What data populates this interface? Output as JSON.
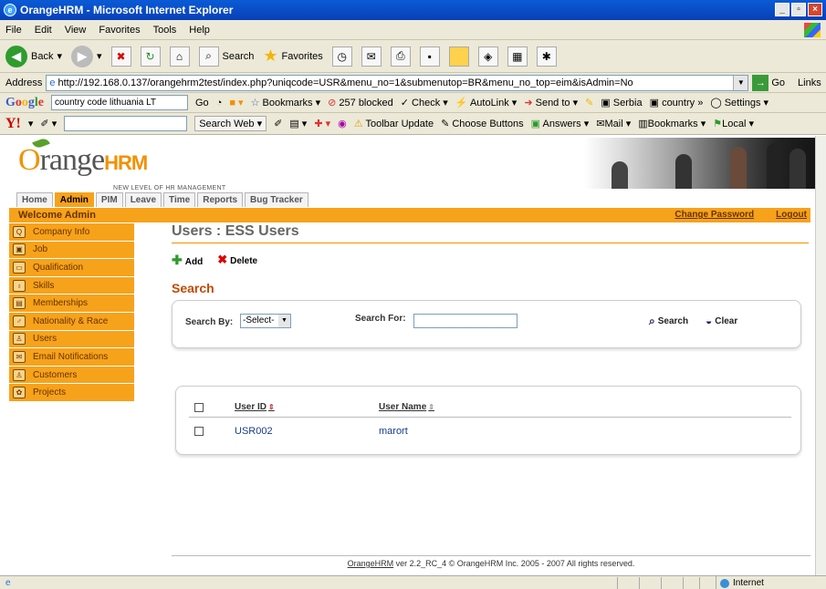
{
  "window": {
    "title": "OrangeHRM - Microsoft Internet Explorer"
  },
  "menu": {
    "items": [
      "File",
      "Edit",
      "View",
      "Favorites",
      "Tools",
      "Help"
    ]
  },
  "toolbar": {
    "back_label": "Back",
    "search_label": "Search",
    "favorites_label": "Favorites"
  },
  "address": {
    "label": "Address",
    "url": "http://192.168.0.137/orangehrm2test/index.php?uniqcode=USR&menu_no=1&submenutop=BR&menu_no_top=eim&isAdmin=No",
    "go_label": "Go",
    "links_label": "Links"
  },
  "google_toolbar": {
    "logo": "Google",
    "search_value": "country code lithuania LT",
    "go_label": "Go",
    "bookmarks_label": "Bookmarks",
    "blocked_label": "257 blocked",
    "check_label": "Check",
    "autolink_label": "AutoLink",
    "sendto_label": "Send to",
    "serbia_label": "Serbia",
    "country_label": "country",
    "settings_label": "Settings"
  },
  "yahoo_toolbar": {
    "logo": "Y!",
    "search_web_label": "Search Web",
    "toolbar_update_label": "Toolbar Update",
    "choose_buttons_label": "Choose Buttons",
    "answers_label": "Answers",
    "mail_label": "Mail",
    "bookmarks_label": "Bookmarks",
    "local_label": "Local"
  },
  "app": {
    "logo_text": "range",
    "logo_suffix": "HRM",
    "tagline": "NEW LEVEL OF HR MANAGEMENT",
    "tabs": [
      {
        "label": "Home",
        "active": false
      },
      {
        "label": "Admin",
        "active": true
      },
      {
        "label": "PIM",
        "active": false
      },
      {
        "label": "Leave",
        "active": false
      },
      {
        "label": "Time",
        "active": false
      },
      {
        "label": "Reports",
        "active": false
      },
      {
        "label": "Bug Tracker",
        "active": false
      }
    ],
    "welcome": "Welcome Admin",
    "change_password": "Change Password",
    "logout": "Logout",
    "sidebar": [
      "Company Info",
      "Job",
      "Qualification",
      "Skills",
      "Memberships",
      "Nationality & Race",
      "Users",
      "Email Notifications",
      "Customers",
      "Projects"
    ],
    "page_title": "Users : ESS Users",
    "add_label": "Add",
    "delete_label": "Delete",
    "search_title": "Search",
    "search_by_label": "Search By:",
    "search_by_value": "-Select-",
    "search_for_label": "Search For:",
    "search_for_value": "",
    "search_button": "Search",
    "clear_button": "Clear",
    "table": {
      "columns": [
        "User ID",
        "User Name"
      ],
      "rows": [
        {
          "user_id": "USR002",
          "user_name": "marort"
        }
      ]
    },
    "footer_link": "OrangeHRM",
    "footer_text": " ver 2.2_RC_4 © OrangeHRM Inc. 2005 - 2007 All rights reserved."
  },
  "status": {
    "zone": "Internet"
  },
  "colors": {
    "accent": "#f7a21b",
    "title_bar": "#0a5bd6",
    "link": "#1a3c8a"
  }
}
